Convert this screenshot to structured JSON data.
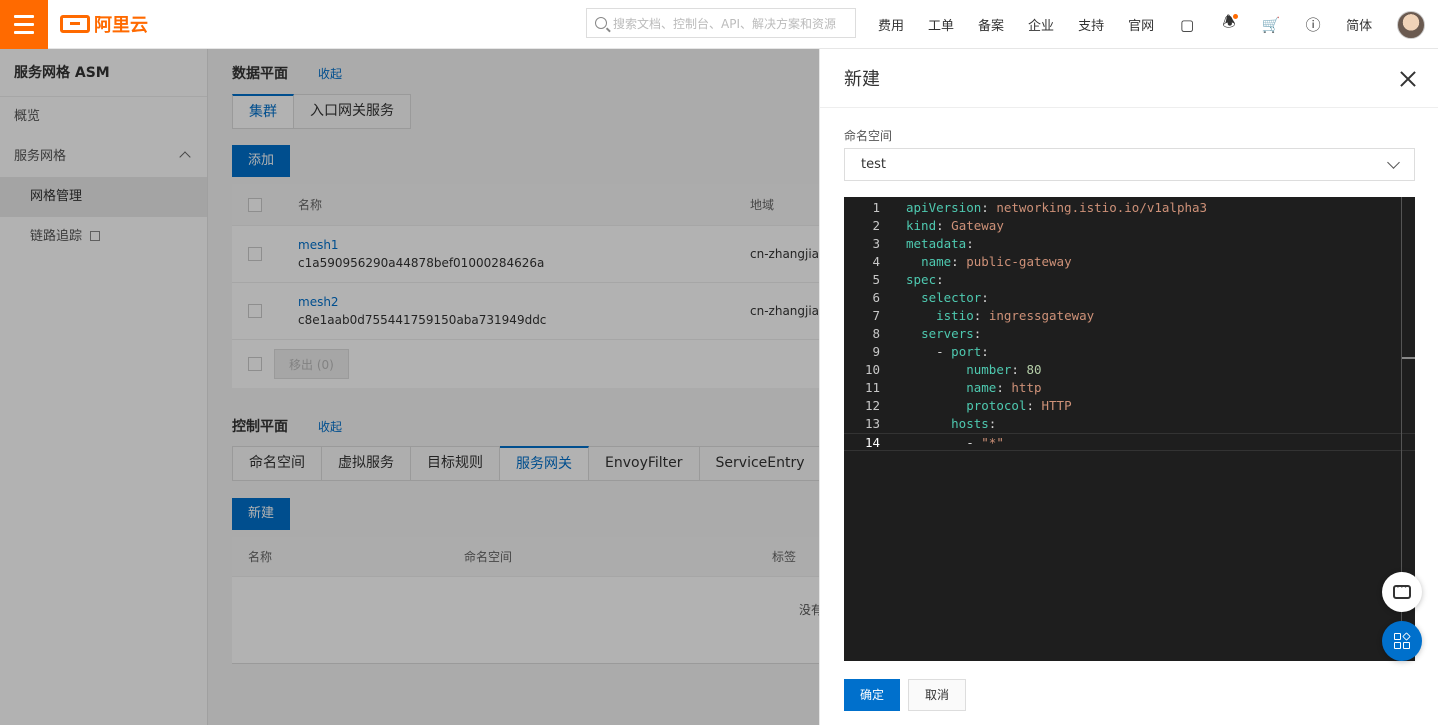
{
  "topbar": {
    "logo_text": "阿里云",
    "search_placeholder": "搜索文档、控制台、API、解决方案和资源",
    "nav": [
      "费用",
      "工单",
      "备案",
      "企业",
      "支持",
      "官网"
    ],
    "lang": "简体"
  },
  "sidebar": {
    "title": "服务网格 ASM",
    "items": [
      {
        "label": "概览"
      },
      {
        "label": "服务网格"
      },
      {
        "label": "网格管理"
      },
      {
        "label": "链路追踪"
      }
    ]
  },
  "data_plane": {
    "title": "数据平面",
    "collapse_label": "收起",
    "tabs": [
      "集群",
      "入口网关服务"
    ],
    "add_label": "添加",
    "columns": [
      "名称",
      "地域"
    ],
    "rows": [
      {
        "name": "mesh1",
        "id": "c1a590956290a44878bef01000284626a",
        "region": "cn-zhangjial"
      },
      {
        "name": "mesh2",
        "id": "c8e1aab0d755441759150aba731949ddc",
        "region": "cn-zhangjial"
      }
    ],
    "remove_label": "移出 (0)"
  },
  "control_plane": {
    "title": "控制平面",
    "collapse_label": "收起",
    "tabs": [
      "命名空间",
      "虚拟服务",
      "目标规则",
      "服务网关",
      "EnvoyFilter",
      "ServiceEntry"
    ],
    "active_tab": "服务网关",
    "new_label": "新建",
    "columns": [
      "名称",
      "命名空间",
      "标签"
    ],
    "empty_text": "没有"
  },
  "drawer": {
    "title": "新建",
    "namespace_label": "命名空间",
    "namespace_value": "test",
    "ok_label": "确定",
    "cancel_label": "取消",
    "code_lines": [
      {
        "n": "1",
        "k": "apiVersion",
        "v": "networking.istio.io/v1alpha3",
        "indent": ""
      },
      {
        "n": "2",
        "k": "kind",
        "v": "Gateway",
        "indent": ""
      },
      {
        "n": "3",
        "k": "metadata",
        "v": "",
        "indent": ""
      },
      {
        "n": "4",
        "k": "name",
        "v": "public-gateway",
        "indent": "  "
      },
      {
        "n": "5",
        "k": "spec",
        "v": "",
        "indent": ""
      },
      {
        "n": "6",
        "k": "selector",
        "v": "",
        "indent": "  "
      },
      {
        "n": "7",
        "k": "istio",
        "v": "ingressgateway",
        "indent": "    "
      },
      {
        "n": "8",
        "k": "servers",
        "v": "",
        "indent": "  "
      },
      {
        "n": "9",
        "k": "port",
        "v": "",
        "indent": "    - "
      },
      {
        "n": "10",
        "k": "number",
        "v": "80",
        "indent": "        ",
        "numeric": true
      },
      {
        "n": "11",
        "k": "name",
        "v": "http",
        "indent": "        "
      },
      {
        "n": "12",
        "k": "protocol",
        "v": "HTTP",
        "indent": "        "
      },
      {
        "n": "13",
        "k": "hosts",
        "v": "",
        "indent": "      "
      },
      {
        "n": "14",
        "k": "",
        "v": "\"*\"",
        "indent": "        - "
      }
    ]
  }
}
